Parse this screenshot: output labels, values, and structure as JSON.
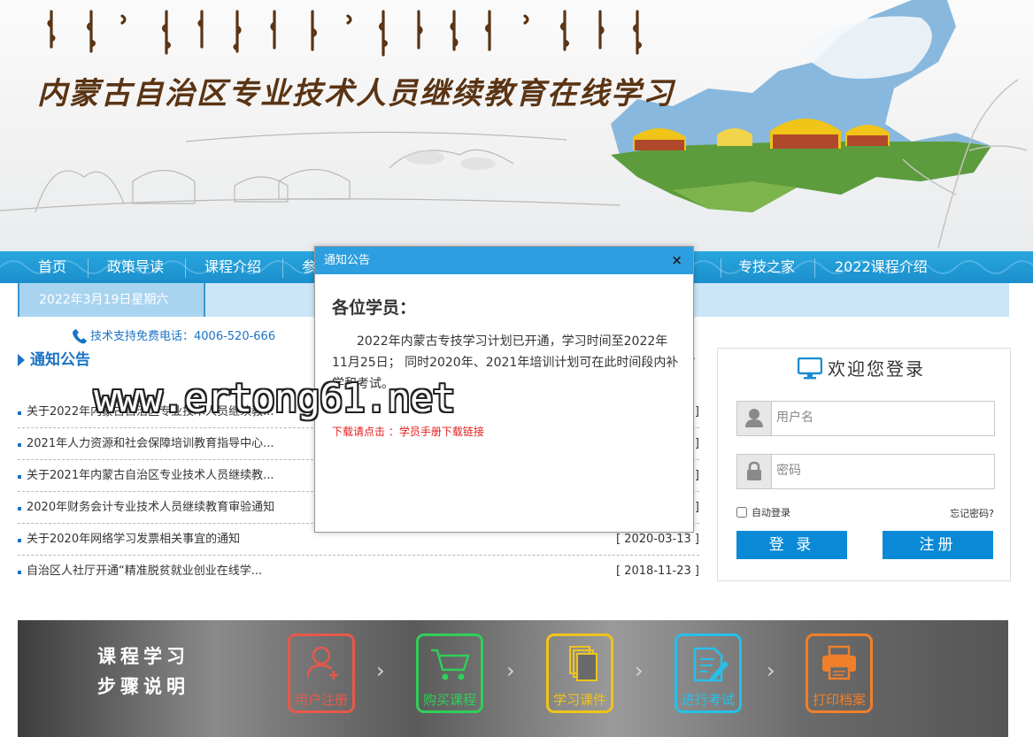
{
  "banner": {
    "title": "内蒙古自治区专业技术人员继续教育在线学习"
  },
  "nav": {
    "items": [
      {
        "label": "首页"
      },
      {
        "label": "政策导读"
      },
      {
        "label": "课程介绍"
      },
      {
        "label": "参"
      },
      {
        "label": "专技之家"
      },
      {
        "label": "2022课程介绍"
      }
    ]
  },
  "datebar": {
    "date": "2022年3月19日星期六"
  },
  "support": {
    "text": "技术支持免费电话：4006-520-666"
  },
  "notices": {
    "heading": "通知公告",
    "more": "›",
    "items": [
      {
        "title": "关于2022年内蒙古自治区专业技术人员继续教...",
        "date": "]"
      },
      {
        "title": "2021年人力资源和社会保障培训教育指导中心...",
        "date": "]"
      },
      {
        "title": "关于2021年内蒙古自治区专业技术人员继续教...",
        "date": "]"
      },
      {
        "title": "2020年财务会计专业技术人员继续教育审验通知",
        "date": "]"
      },
      {
        "title": "关于2020年网络学习发票相关事宜的通知",
        "date": "[ 2020-03-13 ]"
      },
      {
        "title": "自治区人社厅开通“精准脱贫就业创业在线学...",
        "date": "[ 2018-11-23 ]"
      }
    ]
  },
  "login": {
    "title": "欢迎您登录",
    "username_placeholder": "用户名",
    "password_placeholder": "密码",
    "remember_label": "自动登录",
    "forgot_label": "忘记密码?",
    "login_button": "登 录",
    "register_button": "注册"
  },
  "steps": {
    "heading_line1": "课程学习",
    "heading_line2": "步骤说明",
    "items": [
      {
        "label": "用户注册",
        "color": "#e8584a",
        "icon": "user-add-icon"
      },
      {
        "label": "购买课程",
        "color": "#2fcf58",
        "icon": "cart-icon"
      },
      {
        "label": "学习课件",
        "color": "#f0c419",
        "icon": "pages-icon"
      },
      {
        "label": "进行考试",
        "color": "#26c0e8",
        "icon": "exam-edit-icon"
      },
      {
        "label": "打印档案",
        "color": "#f07f2a",
        "icon": "printer-icon"
      }
    ],
    "arrow": "›"
  },
  "modal": {
    "title": "通知公告",
    "close": "×",
    "greeting": "各位学员：",
    "body": "2022年内蒙古专技学习计划已开通，学习时间至2022年11月25日； 同时2020年、2021年培训计划可在此时间段内补学和考试。",
    "download_link": "下载请点击 ：学员手册下载链接"
  },
  "watermark": "www.ertong61.net",
  "colors": {
    "nav_blue": "#1f9bd8",
    "link_blue": "#1a73c4",
    "button_blue": "#0a8ad6",
    "modal_header": "#2d9fe0",
    "alert_red": "#e41b1b"
  }
}
